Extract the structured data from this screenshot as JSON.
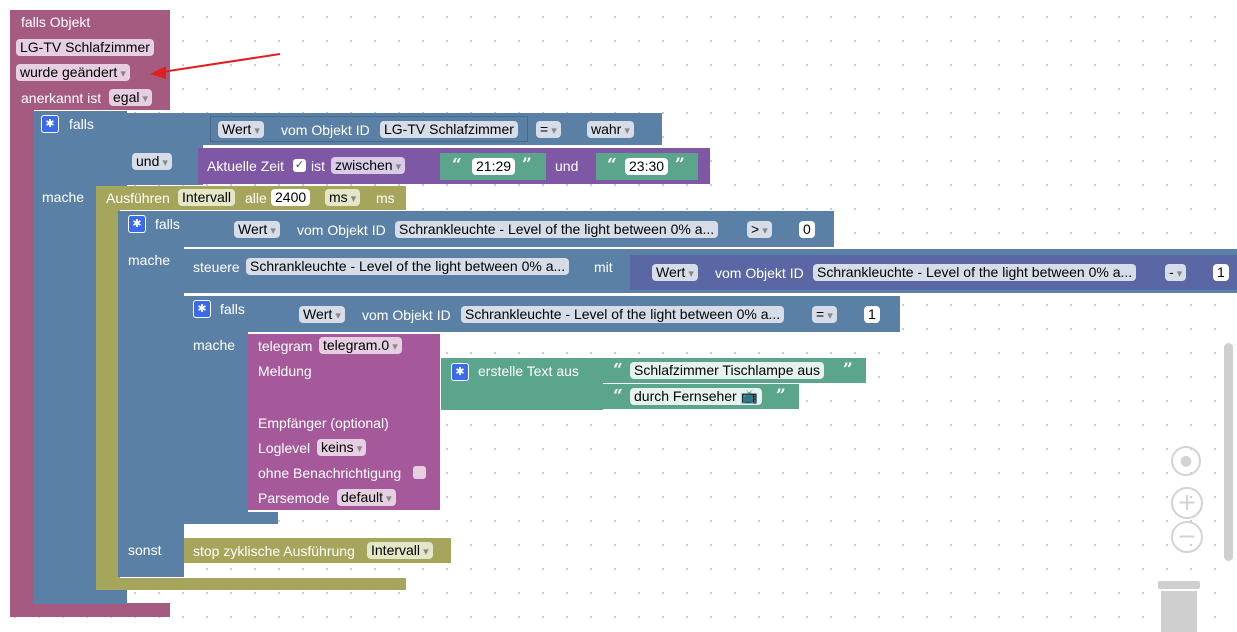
{
  "trigger": {
    "header": "falls Objekt",
    "object": "LG-TV Schlafzimmer",
    "event": "wurde geändert",
    "ack_label": "anerkannt ist",
    "ack_value": "egal"
  },
  "if1": {
    "falls": "falls",
    "wert": "Wert",
    "vom_objekt_id": "vom Objekt ID",
    "object": "LG-TV Schlafzimmer",
    "op": "=",
    "value": "wahr",
    "und": "und",
    "aktuelle_zeit": "Aktuelle Zeit",
    "ist": "ist",
    "zwischen": "zwischen",
    "time_from": "21:29",
    "und2": "und",
    "time_to": "23:30",
    "mache": "mache"
  },
  "interval": {
    "ausfuehren": "Ausführen",
    "intervall": "Intervall",
    "alle": "alle",
    "ms_value": "2400",
    "ms_unit": "ms",
    "ms_label": "ms"
  },
  "if2": {
    "falls": "falls",
    "wert": "Wert",
    "vom_objekt_id": "vom Objekt ID",
    "object": "Schrankleuchte - Level of the light between 0% a...",
    "op": ">",
    "value": "0",
    "mache": "mache",
    "sonst": "sonst"
  },
  "steuere": {
    "label": "steuere",
    "object": "Schrankleuchte - Level of the light between 0% a...",
    "mit": "mit",
    "wert": "Wert",
    "vom_objekt_id": "vom Objekt ID",
    "inner_object": "Schrankleuchte - Level of the light between 0% a...",
    "op": "-",
    "value": "1"
  },
  "if3": {
    "falls": "falls",
    "wert": "Wert",
    "vom_objekt_id": "vom Objekt ID",
    "object": "Schrankleuchte - Level of the light between 0% a...",
    "op": "=",
    "value": "1",
    "mache": "mache"
  },
  "telegram": {
    "label": "telegram",
    "instance": "telegram.0",
    "meldung": "Meldung",
    "erstelle_text": "erstelle Text aus",
    "text1": "Schlafzimmer Tischlampe aus",
    "text2": "durch Fernseher 📺",
    "empfaenger": "Empfänger (optional)",
    "loglevel": "Loglevel",
    "loglevel_value": "keins",
    "ohne_benachrichtigung": "ohne Benachrichtigung",
    "parsemode": "Parsemode",
    "parsemode_value": "default"
  },
  "stop": {
    "label": "stop zyklische Ausführung",
    "value": "Intervall"
  },
  "colors": {
    "event": "#a55b80",
    "logic": "#5b80a5",
    "timer": "#a5a55b",
    "time": "#7e57a5",
    "messaging": "#a5599a",
    "text": "#5ba58c",
    "annotation_arrow": "#e02020"
  }
}
